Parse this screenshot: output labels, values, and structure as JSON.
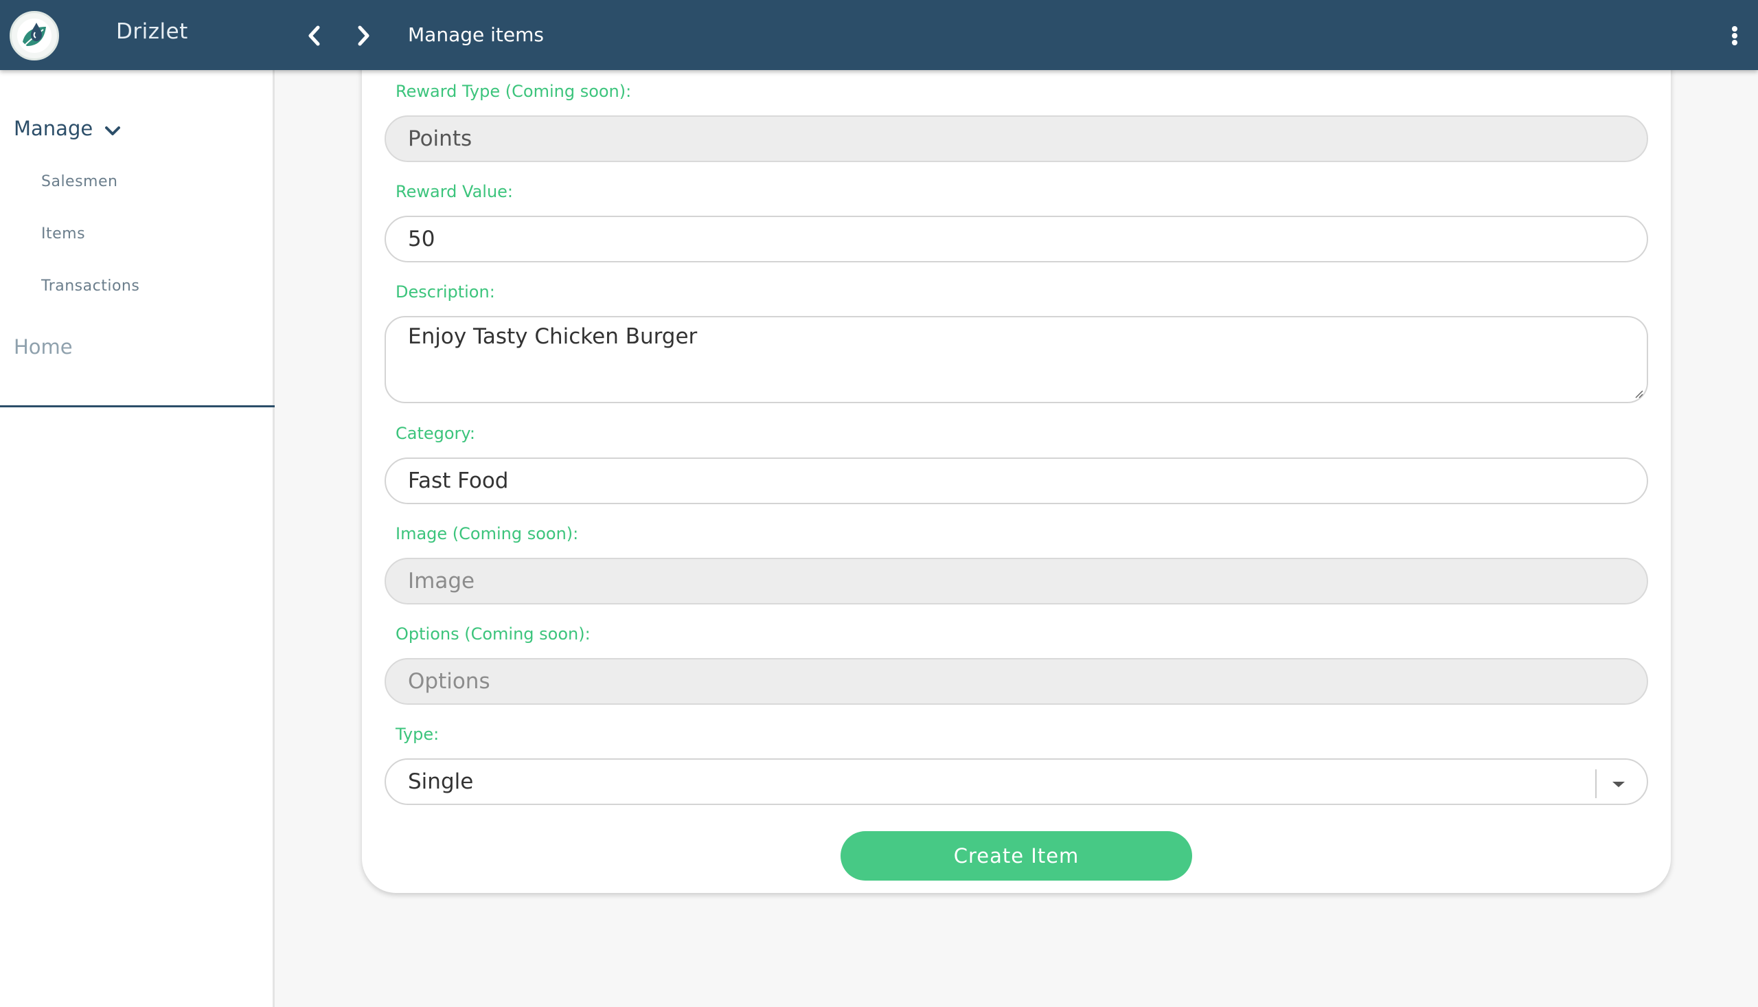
{
  "app": {
    "name": "Drizlet",
    "page_title": "Manage items"
  },
  "sidebar": {
    "manage_label": "Manage",
    "items": [
      {
        "label": "Salesmen"
      },
      {
        "label": "Items"
      },
      {
        "label": "Transactions"
      }
    ],
    "home_label": "Home"
  },
  "form": {
    "reward_type": {
      "label": "Reward Type (Coming soon):",
      "value": "Points"
    },
    "reward_value": {
      "label": "Reward Value:",
      "value": "50"
    },
    "description": {
      "label": "Description:",
      "value": "Enjoy Tasty Chicken Burger"
    },
    "category": {
      "label": "Category:",
      "value": "Fast Food"
    },
    "image": {
      "label": "Image (Coming soon):",
      "placeholder": "Image"
    },
    "options": {
      "label": "Options (Coming soon):",
      "placeholder": "Options"
    },
    "type": {
      "label": "Type:",
      "value": "Single"
    },
    "submit_label": "Create Item"
  },
  "colors": {
    "topbar": "#2c4e69",
    "accent_green": "#47c985",
    "label_green": "#3cc47c"
  },
  "icons": {
    "logo": "leaf-drop-logo",
    "back": "chevron-left-icon",
    "forward": "chevron-right-icon",
    "menu": "kebab-menu-icon",
    "manage_toggle": "chevron-down-icon",
    "select_caret": "caret-down-icon"
  }
}
